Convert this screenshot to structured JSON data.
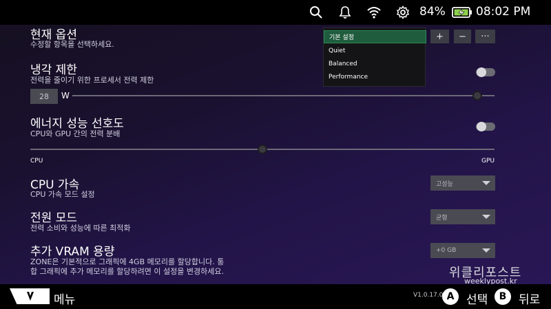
{
  "status": {
    "battery_pct": "84%",
    "time": "08:02 PM",
    "icons": [
      "search-icon",
      "bell-icon",
      "wifi-icon",
      "gear-icon",
      "battery-charging-icon"
    ]
  },
  "profile": {
    "title": "현재 옵션",
    "subtitle": "수정할 항목을 선택하세요.",
    "buttons": {
      "add": "+",
      "remove": "−",
      "more": "···"
    },
    "dropdown": {
      "options": [
        "기본 설정",
        "Quiet",
        "Balanced",
        "Performance"
      ],
      "selected": "기본 설정"
    }
  },
  "cooling": {
    "title": "냉각 제한",
    "subtitle": "전력을 줄이기 위한 프로세서 전력 제한",
    "value": "28",
    "unit": "W",
    "toggle_on": false,
    "slider_position": 0.96
  },
  "energy": {
    "title": "에너지 성능 선호도",
    "subtitle": "CPU와 GPU 간의 전력 분배",
    "left_label": "CPU",
    "right_label": "GPU",
    "toggle_on": false,
    "slider_position": 0.5
  },
  "cpu_boost": {
    "title": "CPU 가속",
    "subtitle": "CPU 가속 모드 설정",
    "value": "고성능"
  },
  "power_mode": {
    "title": "전원 모드",
    "subtitle": "전력 소비와 성능에 따른 최적화",
    "value": "균형"
  },
  "vram": {
    "title": "추가 VRAM 용량",
    "subtitle_line1": "ZONE은 기본적으로 그래픽에 4GB 메모리를 할당합니다. 통",
    "subtitle_line2": "합 그래픽에 추가 메모리를 할당하려면 이 설정을 변경하세요.",
    "value": "+0 GB"
  },
  "bottom": {
    "menu_label": "메뉴",
    "version": "V1.0.17.0",
    "a_key": "A",
    "a_label": "선택",
    "b_key": "B",
    "b_label": "뒤로"
  },
  "watermark": {
    "logo": "위클리포스트",
    "url": "weeklypost.kr"
  },
  "colors": {
    "accent_selected": "#1f5c3d",
    "bg_purple": "#2a1757"
  }
}
